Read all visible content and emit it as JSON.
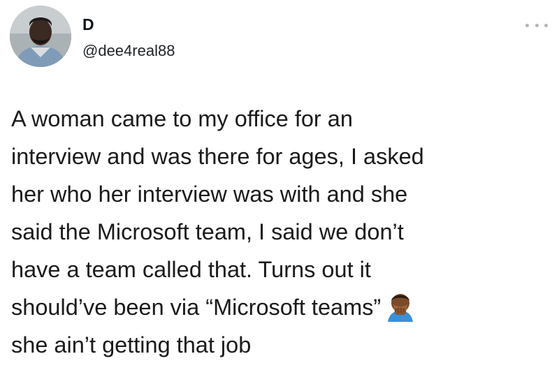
{
  "tweet": {
    "author": {
      "name": "D",
      "handle": "@dee4real88"
    },
    "lines": [
      "A woman came to my office for an",
      "interview and was there for ages, I asked",
      "her who her interview was with and she",
      "said the Microsoft team, I said we don’t",
      "have a team called that. Turns out it",
      "should’ve been via “Microsoft teams”",
      "she ain’t getting that job"
    ],
    "emoji": "face-palm-emoji",
    "more_icon": "more-options-icon"
  },
  "colors": {
    "text": "#0f1419",
    "handle": "#1f2328",
    "icon_gray": "#b0b6bb",
    "background": "#ffffff"
  }
}
